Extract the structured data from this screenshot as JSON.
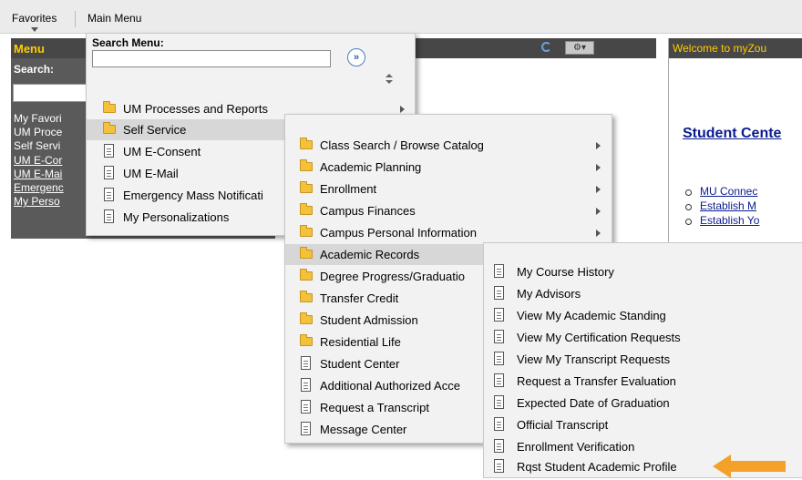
{
  "top_nav": {
    "favorites": "Favorites",
    "main_menu": "Main Menu"
  },
  "menu_pagelet": {
    "title": "Menu",
    "search_label": "Search:",
    "items": [
      "My Favori",
      "UM Proce",
      "Self Servi",
      "UM E-Cor",
      "UM E-Mai",
      "Emergenc",
      "My Perso"
    ]
  },
  "welcome_pagelet": {
    "title": "Welcome to myZou",
    "heading": "Student Cente",
    "links": [
      "MU Connec",
      "Establish M",
      "Establish Yo"
    ]
  },
  "main_menu": {
    "search_label": "Search Menu:",
    "search_value": "",
    "items": [
      "UM Processes and Reports",
      "Self Service",
      "UM E-Consent",
      "UM E-Mail",
      "Emergency Mass Notificati",
      "My Personalizations"
    ]
  },
  "self_service_menu": {
    "items": [
      "Class Search / Browse Catalog",
      "Academic Planning",
      "Enrollment",
      "Campus Finances",
      "Campus Personal Information",
      "Academic Records",
      "Degree Progress/Graduatio",
      "Transfer Credit",
      "Student Admission",
      "Residential Life",
      "Student Center",
      "Additional Authorized Acce",
      "Request a Transcript",
      "Message Center"
    ]
  },
  "academic_records_menu": {
    "items": [
      "My Course History",
      "My Advisors",
      "View My Academic Standing",
      "View My Certification Requests",
      "View My Transcript Requests",
      "Request a Transfer Evaluation",
      "Expected Date of Graduation",
      "Official Transcript",
      "Enrollment Verification",
      "Rqst Student Academic Profile"
    ]
  },
  "colors": {
    "arrow": "#f4a12a",
    "header_title": "#ffcc00",
    "link": "#0a1c8e"
  }
}
